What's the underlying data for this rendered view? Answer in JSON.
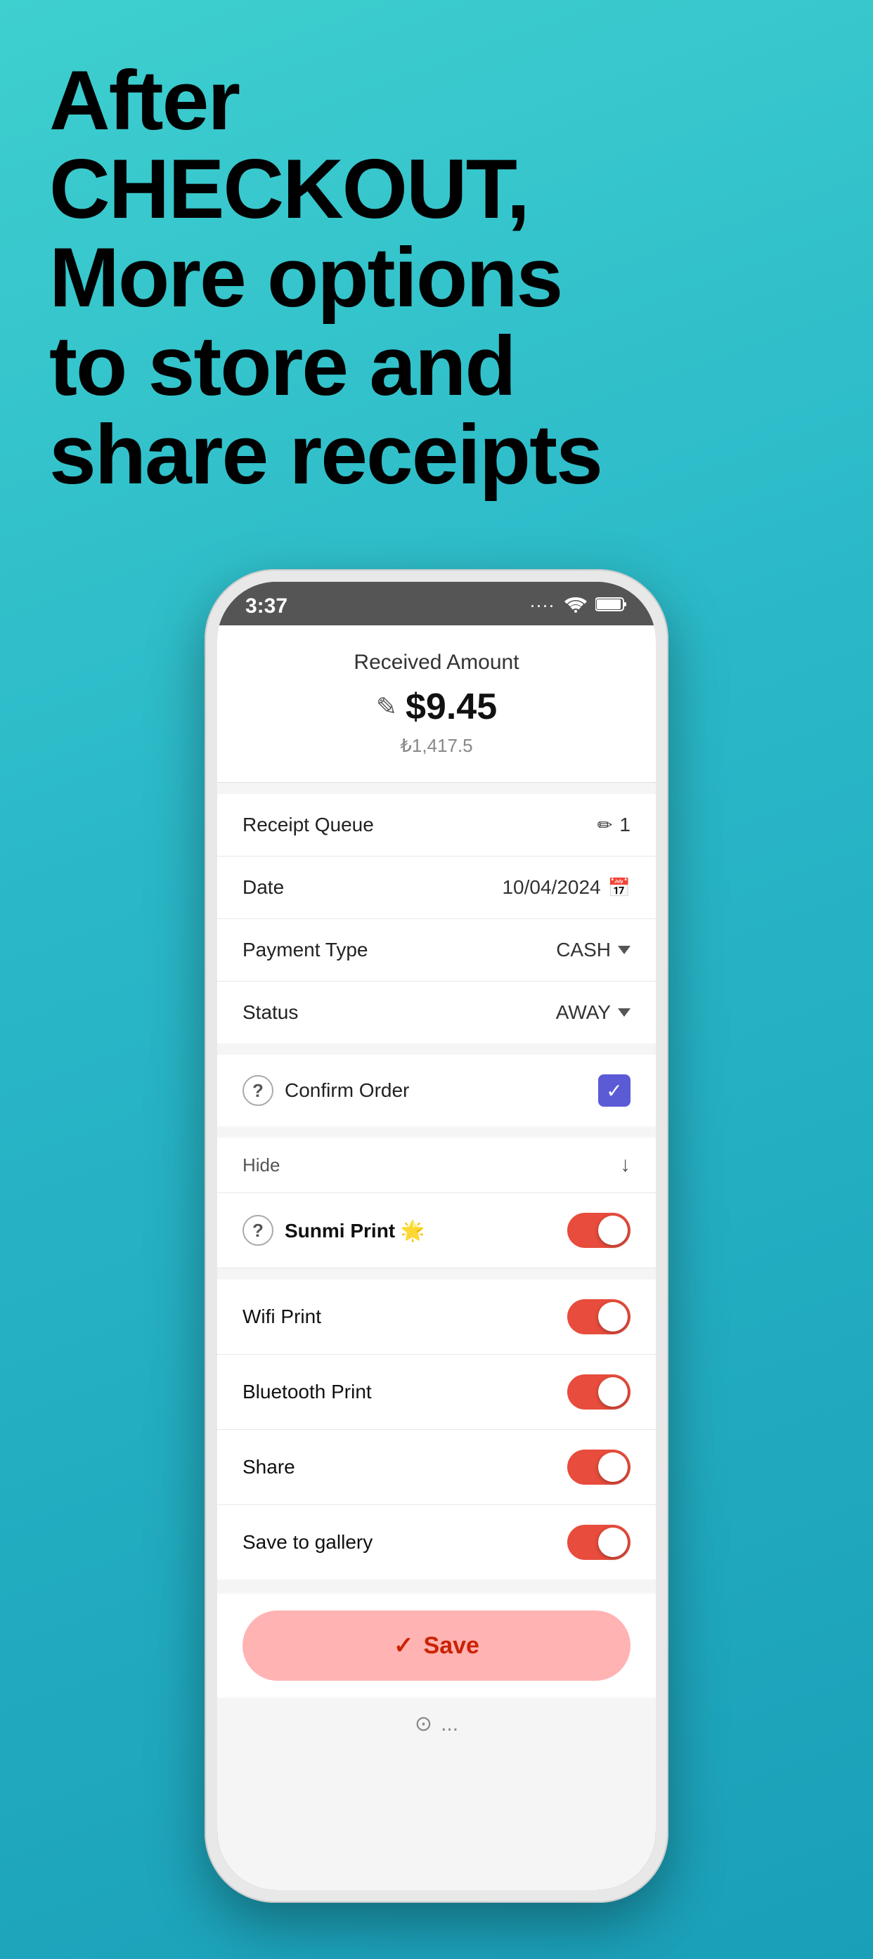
{
  "headline": {
    "line1": "After",
    "line2": "CHECKOUT,",
    "line3": "More options",
    "line4": "to store and",
    "line5": "share receipts"
  },
  "statusBar": {
    "time": "3:37",
    "icons": "wifi battery"
  },
  "receivedAmount": {
    "title": "Received Amount",
    "amount": "$9.45",
    "subAmount": "₺1,417.5"
  },
  "rows": {
    "receiptQueue": {
      "label": "Receipt Queue",
      "value": "1"
    },
    "date": {
      "label": "Date",
      "value": "10/04/2024"
    },
    "paymentType": {
      "label": "Payment Type",
      "value": "CASH"
    },
    "status": {
      "label": "Status",
      "value": "AWAY"
    }
  },
  "confirmOrder": {
    "label": "Confirm Order",
    "checked": true
  },
  "hide": {
    "label": "Hide"
  },
  "sunmi": {
    "label": "Sunmi Print 🌟",
    "enabled": true
  },
  "options": [
    {
      "label": "Wifi Print",
      "enabled": true
    },
    {
      "label": "Bluetooth Print",
      "enabled": true
    },
    {
      "label": "Share",
      "enabled": true
    },
    {
      "label": "Save to gallery",
      "enabled": true
    }
  ],
  "saveButton": {
    "label": "Save"
  },
  "bottomBar": {
    "icon": "⊙",
    "text": "..."
  }
}
